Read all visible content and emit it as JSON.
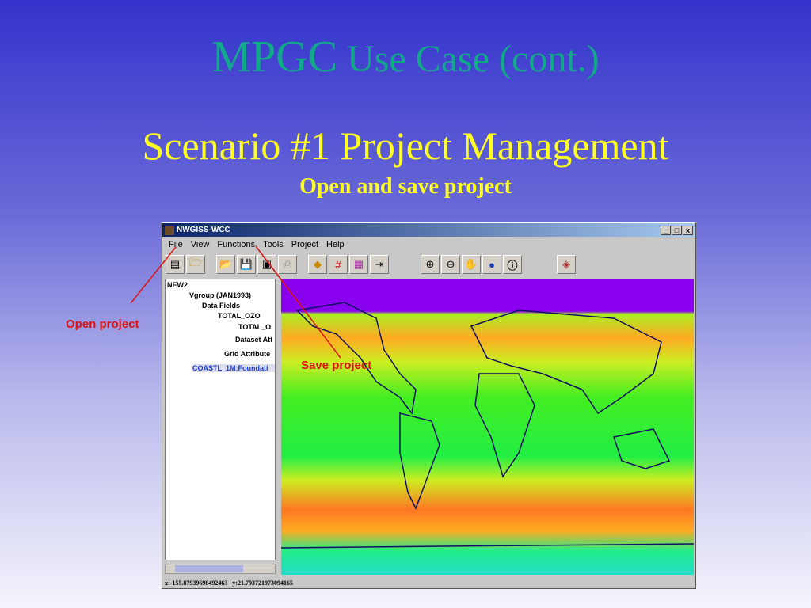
{
  "slide": {
    "title_big": "MPGC",
    "title_rest": "Use Case (cont.)",
    "subtitle": "Scenario #1 Project Management",
    "subtitle2": "Open and save project"
  },
  "window": {
    "title": "NWGISS-WCC",
    "controls": [
      "_",
      "□",
      "x"
    ],
    "menu": [
      "File",
      "View",
      "Functions",
      "Tools",
      "Project",
      "Help"
    ],
    "tree": {
      "root": "NEW2",
      "vgroup": "Vgroup (JAN1993)",
      "data_fields": "Data Fields",
      "total_oz1": "TOTAL_OZO",
      "total_oz2": "TOTAL_O.",
      "dataset_attr": "Dataset Att",
      "grid_attr": "Grid Attribute",
      "coastl": "COASTL_1M:Foundati"
    },
    "status": {
      "x": "x:-155.87939698492463",
      "y": "y:21.793721973094165"
    }
  },
  "annotations": {
    "open": "Open project",
    "save": "Save project"
  },
  "colors": {
    "accent_red": "#dd1111"
  }
}
